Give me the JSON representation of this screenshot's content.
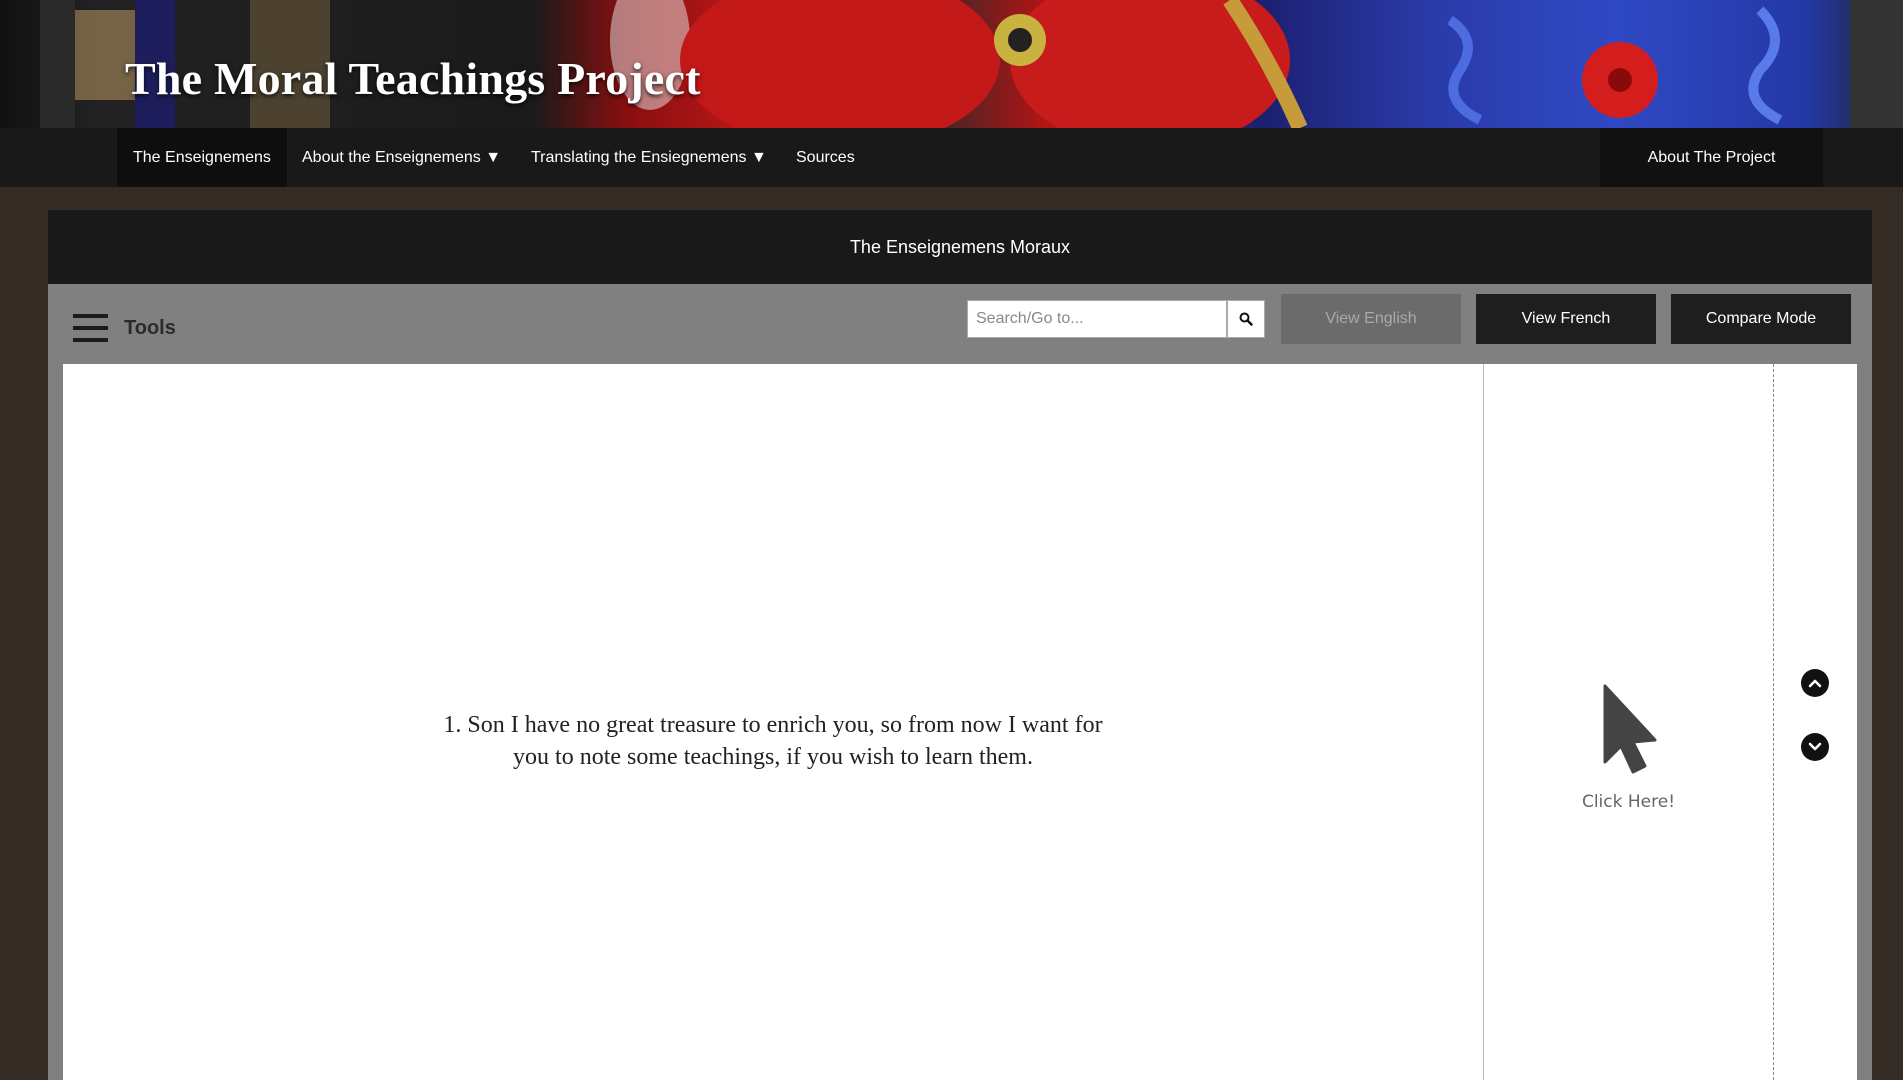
{
  "site": {
    "title": "The Moral Teachings Project"
  },
  "nav": {
    "items": [
      {
        "label": "The Enseignemens"
      },
      {
        "label": "About the Enseignemens ▼"
      },
      {
        "label": "Translating the Ensiegnemens ▼"
      },
      {
        "label": "Sources"
      }
    ],
    "right": {
      "label": "About The Project"
    }
  },
  "panel": {
    "header": "The Enseignemens Moraux",
    "toolbar": {
      "tools_label": "Tools",
      "search_placeholder": "Search/Go to...",
      "buttons": {
        "view_english": "View English",
        "view_french": "View French",
        "compare_mode": "Compare Mode"
      }
    },
    "verse": {
      "text": "1. Son I have no great treasure to enrich you, so from now I want for you to note some teachings, if you wish to learn them."
    },
    "side": {
      "click_label": "Click Here!"
    }
  },
  "icons": {
    "menu": "hamburger-icon",
    "search": "search-icon",
    "cursor": "cursor-pointer-icon",
    "up": "chevron-up-icon",
    "down": "chevron-down-icon"
  },
  "colors": {
    "background": "#342b25",
    "nav": "#191919",
    "panel": "#808080",
    "button_dark": "#1e1e1e",
    "button_disabled": "#6b6b6b"
  }
}
